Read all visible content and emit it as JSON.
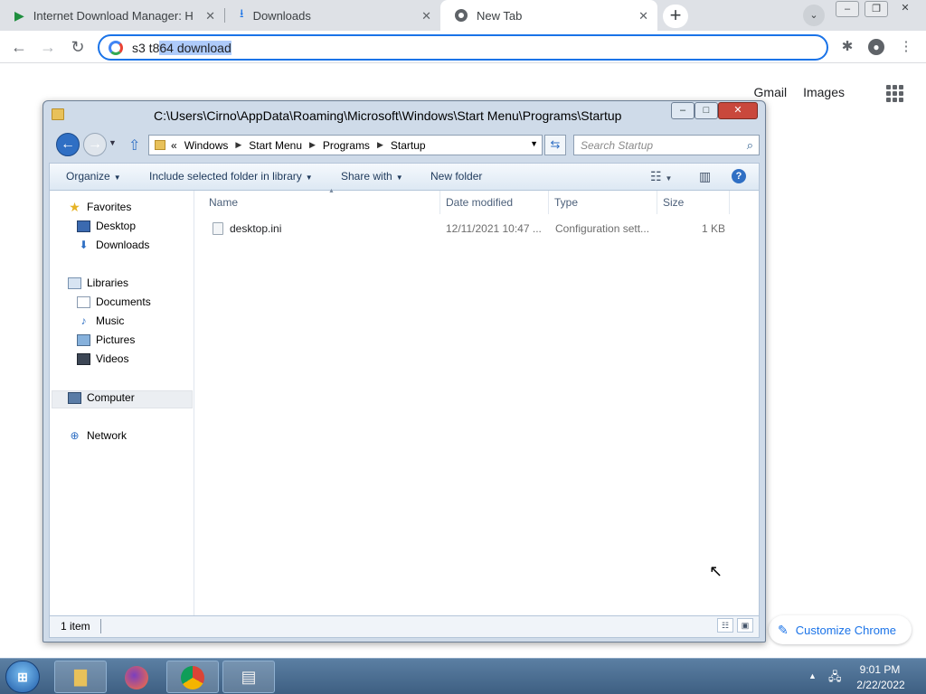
{
  "chrome": {
    "tabs": [
      {
        "title": "Internet Download Manager: Hig",
        "icon": "idm-play-icon"
      },
      {
        "title": "Downloads",
        "icon": "download-arrow-icon"
      },
      {
        "title": "New Tab",
        "icon": "chrome-icon"
      }
    ],
    "new_tab_symbol": "+",
    "omnibox": {
      "typed": "s3 t8",
      "autocomplete": "64 download"
    },
    "ntp": {
      "gmail": "Gmail",
      "images": "Images",
      "customize": "Customize Chrome"
    }
  },
  "explorer": {
    "title": "C:\\Users\\Cirno\\AppData\\Roaming\\Microsoft\\Windows\\Start Menu\\Programs\\Startup",
    "address": {
      "overflow": "«",
      "crumbs": [
        "Windows",
        "Start Menu",
        "Programs",
        "Startup"
      ]
    },
    "search_placeholder": "Search Startup",
    "commands": {
      "organize": "Organize",
      "include": "Include selected folder in library",
      "share": "Share with",
      "new_folder": "New folder"
    },
    "nav": {
      "favorites": "Favorites",
      "desktop": "Desktop",
      "downloads": "Downloads",
      "libraries": "Libraries",
      "documents": "Documents",
      "music": "Music",
      "pictures": "Pictures",
      "videos": "Videos",
      "computer": "Computer",
      "network": "Network"
    },
    "columns": {
      "name": "Name",
      "date": "Date modified",
      "type": "Type",
      "size": "Size"
    },
    "files": [
      {
        "name": "desktop.ini",
        "date": "12/11/2021 10:47 ...",
        "type": "Configuration sett...",
        "size": "1 KB"
      }
    ],
    "status": "1 item"
  },
  "taskbar": {
    "time": "9:01 PM",
    "date": "2/22/2022"
  }
}
